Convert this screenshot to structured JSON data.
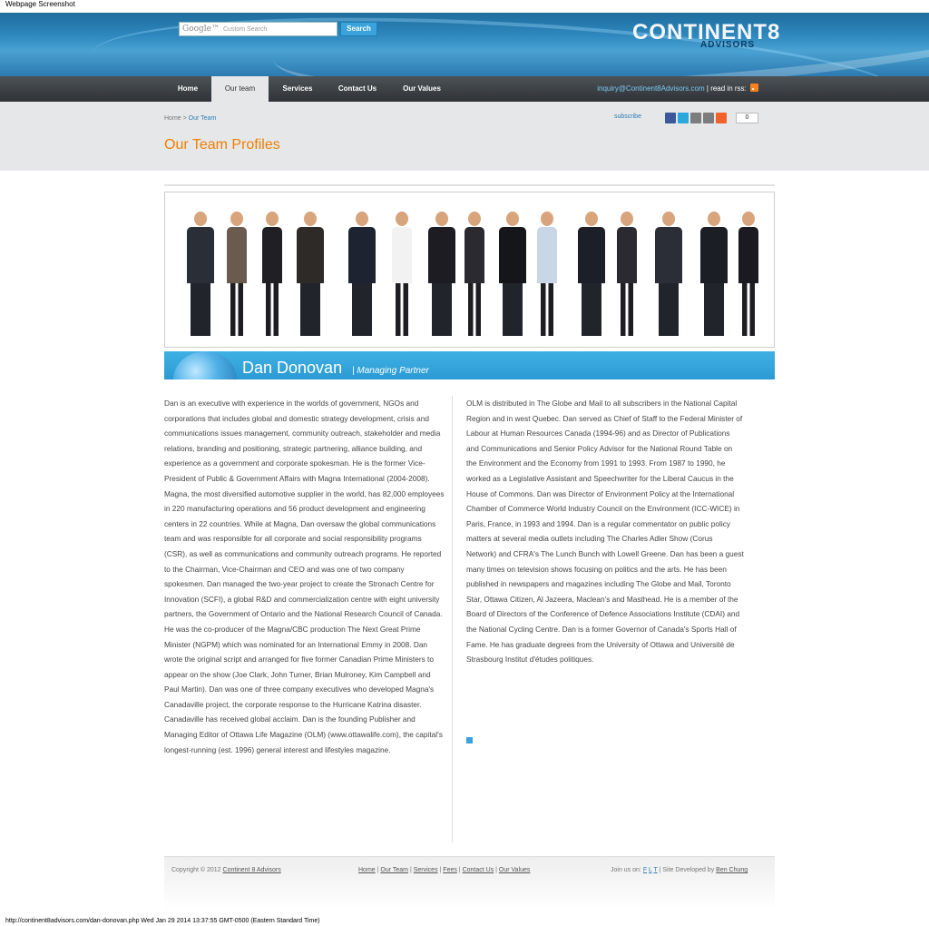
{
  "window": {
    "caption": "Webpage Screenshot",
    "status_line": "http://continent8advisors.com/dan-donovan.php Wed Jan 29 2014 13:37:55 GMT-0500 (Eastern Standard Time)"
  },
  "header": {
    "search_logo": "Google™",
    "search_placeholder": "Custom Search",
    "search_button": "Search",
    "brand": "CONTINENT8",
    "brand_sub": "ADVISORS"
  },
  "nav": {
    "items": [
      "Home",
      "Our team",
      "Services",
      "Contact Us",
      "Our Values"
    ],
    "active": "Our team",
    "email": "inquiry@Continent8Advisors.com",
    "rss_label": "| read in rss:"
  },
  "breadcrumb": {
    "home": "Home",
    "sep": " > ",
    "current": "Our Team"
  },
  "social": {
    "subscribe": "subscribe",
    "count": "0",
    "icons": [
      "facebook-icon",
      "twitter-icon",
      "email-icon",
      "print-icon",
      "addthis-icon"
    ],
    "colors": [
      "#3b5998",
      "#2aa7dd",
      "#7d7d7d",
      "#7d7d7d",
      "#f0642b"
    ]
  },
  "page_title": "Our Team Profiles",
  "profile": {
    "name": "Dan Donovan",
    "title": "| Managing Partner"
  },
  "body": {
    "left": "Dan is an executive with experience in the worlds of government, NGOs and corporations that includes global and domestic strategy development, crisis and communications issues management, community outreach, stakeholder and media relations, branding and positioning, strategic partnering, alliance building, and experience as a government and corporate spokesman. He is the former Vice-President of Public & Government Affairs with Magna International (2004-2008). Magna, the most diversified automotive supplier in the world, has 82,000 employees in 220 manufacturing operations and 56 product development and engineering centers in 22 countries. While at Magna, Dan oversaw the global communications team and was responsible for all corporate and social responsibility programs (CSR), as well as communications and community outreach programs. He reported to the Chairman, Vice-Chairman and CEO and was one of two company spokesmen. Dan managed the two-year project to create the Stronach Centre for Innovation (SCFI), a global R&D and commercialization centre with eight university partners, the Government of Ontario and the National Research Council of Canada. He was the co-producer of the Magna/CBC production The Next Great Prime Minister (NGPM) which was nominated for an International Emmy in 2008. Dan wrote the original script and arranged for five former Canadian Prime Ministers to appear on the show (Joe Clark, John Turner, Brian Mulroney, Kim Campbell and Paul Martin). Dan was one of three company executives who developed Magna's Canadaville project, the corporate response to the Hurricane Katrina disaster. Canadaville has received global acclaim. Dan is the founding Publisher and Managing Editor of Ottawa Life Magazine (OLM) (www.ottawalife.com), the capital's longest-running (est. 1996) general interest and lifestyles magazine.",
    "right": "OLM is distributed in The Globe and Mail to all subscribers in the National Capital Region and in west Quebec. Dan served as Chief of Staff to the Federal Minister of Labour at Human Resources Canada (1994-96) and as Director of Publications and Communications and Senior Policy Advisor for the National Round Table on the Environment and the Economy from 1991 to 1993. From 1987 to 1990, he worked as a Legislative Assistant and Speechwriter for the Liberal Caucus in the House of Commons. Dan was Director of Environment Policy at the International Chamber of Commerce World Industry Council on the Environment (ICC-WICE) in Paris, France, in 1993 and 1994. Dan is a regular commentator on public policy matters at several media outlets including The Charles Adler Show (Corus Network) and CFRA's The Lunch Bunch with Lowell Greene. Dan has been a guest many times on television shows focusing on politics and the arts. He has been published in newspapers and magazines including The Globe and Mail, Toronto Star, Ottawa Citizen, Al Jazeera, Maclean's and Masthead. He is a member of the Board of Directors of the Conference of Defence Associations Institute (CDAI) and the National Cycling Centre. Dan is a former Governor of Canada's Sports Hall of Fame. He has graduate degrees from the University of Ottawa and Université de Strasbourg Institut d'études politiques."
  },
  "footer": {
    "copyright": "Copyright © 2012",
    "company_link": "Continent 8 Advisors",
    "links": [
      "Home",
      "Our Team",
      "Services",
      "Fees",
      "Contact Us",
      "Our Values"
    ],
    "join_label": "Join us on:",
    "social_letters": [
      "F",
      "L",
      "T"
    ],
    "dev_label": "| Site Developed by",
    "dev_link": "Ben Chung"
  }
}
